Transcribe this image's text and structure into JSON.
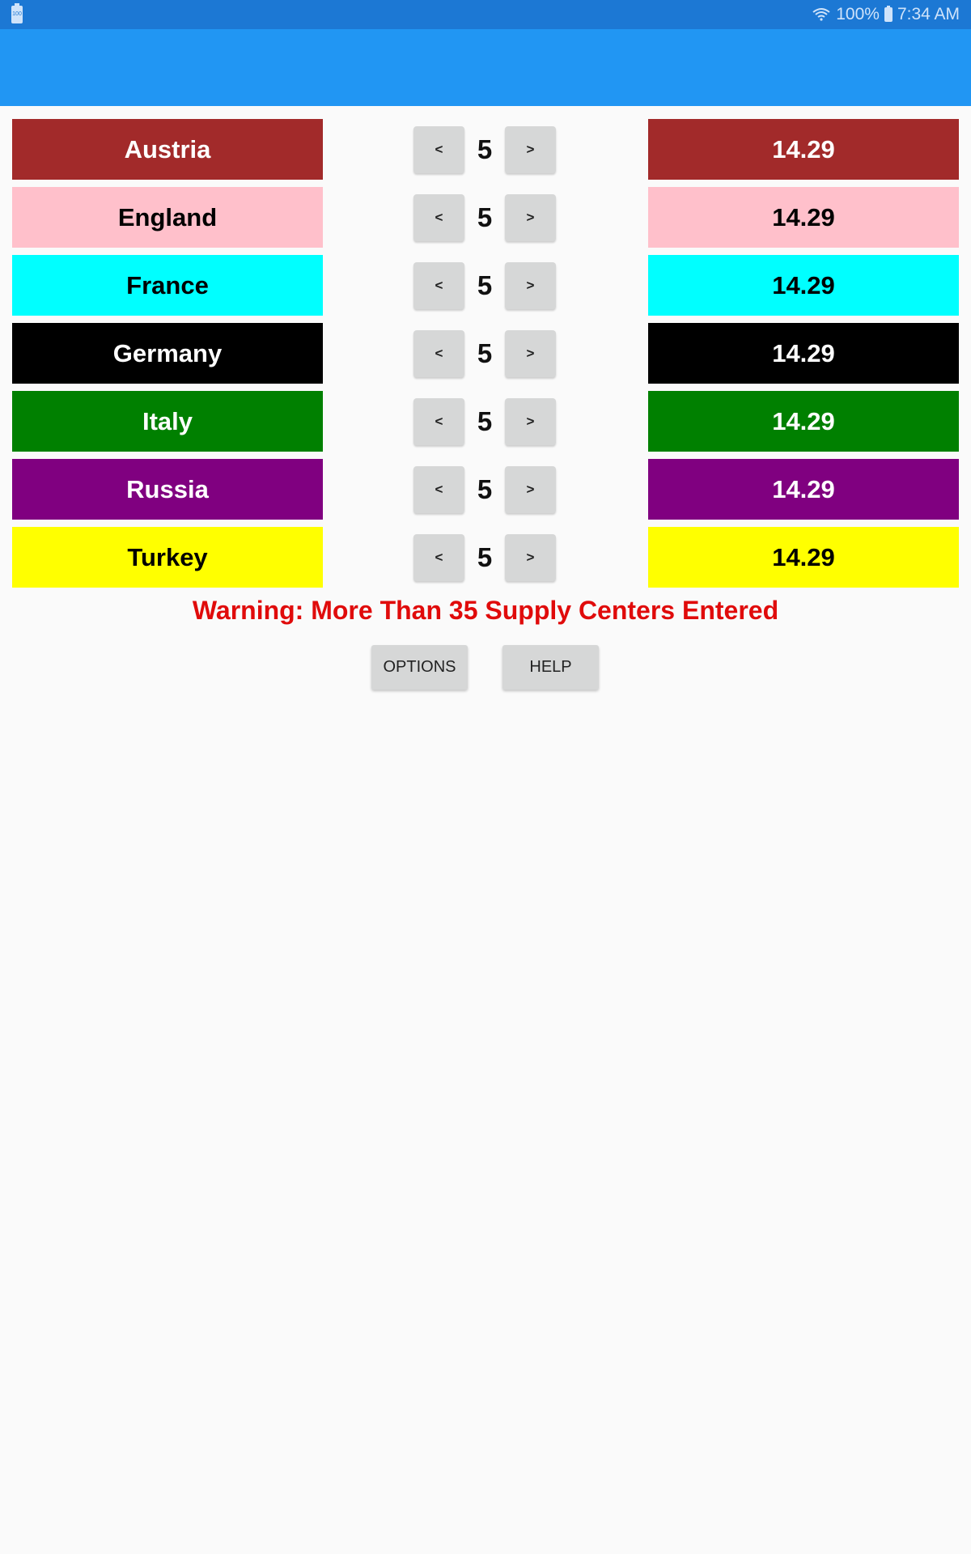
{
  "status_bar": {
    "left_icon": "battery-saver-icon",
    "left_icon_text": "100",
    "wifi_icon": "wifi-icon",
    "battery_percent": "100%",
    "battery_icon": "battery-icon",
    "time": "7:34 AM"
  },
  "colors": {
    "status_bar": "#1c78d4",
    "app_bar": "#2196f3",
    "warning": "#e00b0b",
    "button": "#d6d7d7"
  },
  "powers": [
    {
      "name": "Austria",
      "count": "5",
      "percent": "14.29",
      "bg": "#a22a2a",
      "fg": "#ffffff"
    },
    {
      "name": "England",
      "count": "5",
      "percent": "14.29",
      "bg": "#ffc0cb",
      "fg": "#000000"
    },
    {
      "name": "France",
      "count": "5",
      "percent": "14.29",
      "bg": "#00ffff",
      "fg": "#000000"
    },
    {
      "name": "Germany",
      "count": "5",
      "percent": "14.29",
      "bg": "#000000",
      "fg": "#ffffff"
    },
    {
      "name": "Italy",
      "count": "5",
      "percent": "14.29",
      "bg": "#008000",
      "fg": "#ffffff"
    },
    {
      "name": "Russia",
      "count": "5",
      "percent": "14.29",
      "bg": "#800080",
      "fg": "#ffffff"
    },
    {
      "name": "Turkey",
      "count": "5",
      "percent": "14.29",
      "bg": "#ffff00",
      "fg": "#000000"
    }
  ],
  "stepper": {
    "decrement_label": "<",
    "increment_label": ">"
  },
  "warning": "Warning: More Than 35 Supply Centers Entered",
  "buttons": {
    "options": "OPTIONS",
    "help": "HELP"
  }
}
